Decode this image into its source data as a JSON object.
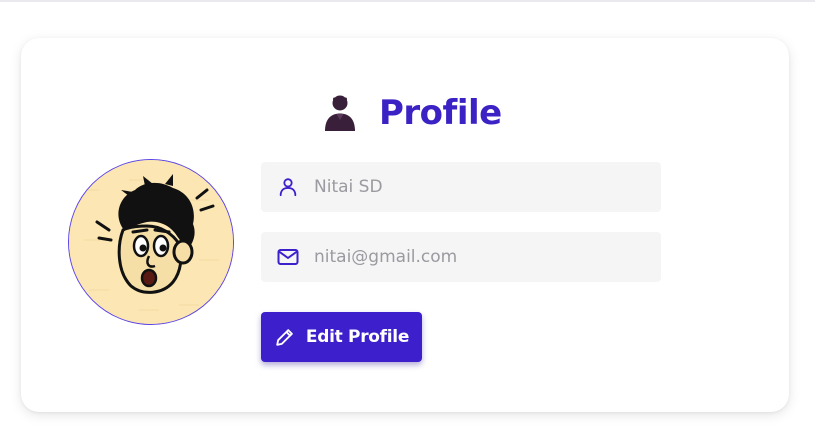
{
  "profile": {
    "title": "Profile",
    "title_icon": "user-silhouette-icon",
    "avatar_image": "cartoon-boy-avatar",
    "name_field": {
      "value": "Nitai SD",
      "icon": "user-outline-icon"
    },
    "email_field": {
      "value": "nitai@gmail.com",
      "icon": "mail-icon"
    },
    "edit_button": {
      "label": "Edit Profile",
      "icon": "pencil-icon"
    }
  },
  "colors": {
    "accent": "#3d1fcc",
    "title": "#3b22c4",
    "avatar_bg": "#fbe6b4",
    "field_bg": "#f5f5f6",
    "title_icon": "#3a1f3a"
  }
}
